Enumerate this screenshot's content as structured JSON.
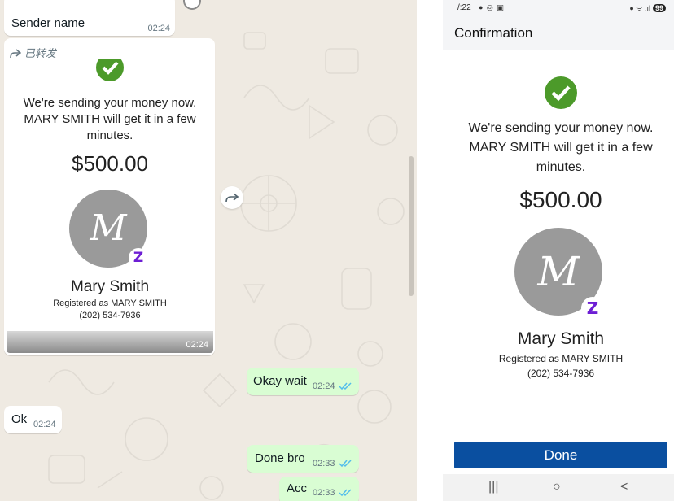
{
  "chat": {
    "sender_message": {
      "text": "Sender name",
      "time": "02:24"
    },
    "forwarded_card": {
      "forward_label": "已转发",
      "message_line1": "We're sending your money now.",
      "message_line2": "MARY SMITH will get it in a few",
      "message_line3": "minutes.",
      "amount": "$500.00",
      "avatar_letter": "M",
      "zelle_symbol": "Z",
      "name": "Mary Smith",
      "registered": "Registered as MARY SMITH",
      "phone": "(202) 534-7936",
      "time": "02:24"
    },
    "messages": [
      {
        "direction": "out",
        "text": "Okay wait",
        "time": "02:24",
        "status": "read"
      },
      {
        "direction": "in",
        "text": "Ok",
        "time": "02:24"
      },
      {
        "direction": "out",
        "text": "Done bro",
        "time": "02:33",
        "status": "read"
      },
      {
        "direction": "out",
        "text": "Acc",
        "time": "02:33",
        "status": "read"
      }
    ]
  },
  "phone": {
    "status_time": "/:22",
    "status_left_icons": "● ◎ ▣",
    "status_right_icons": "● ᯤ .ıl",
    "battery": "99",
    "header_title": "Confirmation",
    "message_line1": "We're sending your money now.",
    "message_line2": "MARY SMITH will get it in a few",
    "message_line3": "minutes.",
    "amount": "$500.00",
    "avatar_letter": "M",
    "zelle_symbol": "Z",
    "name": "Mary Smith",
    "registered": "Registered as MARY SMITH",
    "phone": "(202) 534-7936",
    "done_label": "Done",
    "nav": {
      "recent": "|||",
      "home": "○",
      "back": "<"
    }
  },
  "colors": {
    "chat_background": "#efeae2",
    "outgoing_bubble": "#d9fdd3",
    "read_ticks": "#53bdeb",
    "success_green": "#4c9a2a",
    "done_button": "#0a4fa0",
    "zelle_purple": "#6d1ed4"
  }
}
